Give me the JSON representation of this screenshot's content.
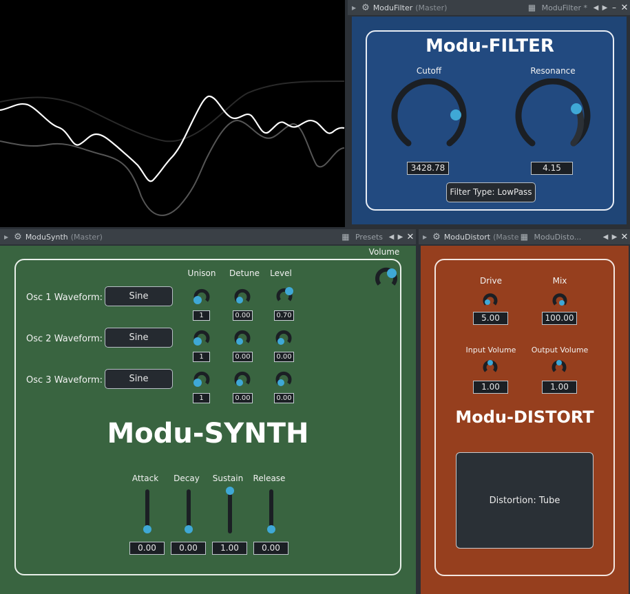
{
  "filter_window": {
    "title": "ModuFilter",
    "subtitle": "(Master)",
    "preset_label": "ModuFilter *",
    "plugin_title": "Modu-FILTER",
    "cutoff_label": "Cutoff",
    "cutoff_value": "3428.78",
    "resonance_label": "Resonance",
    "resonance_value": "4.15",
    "filter_type_button": "Filter Type: LowPass"
  },
  "synth_window": {
    "title": "ModuSynth",
    "subtitle": "(Master)",
    "preset_label": "Presets",
    "volume_label": "Volume",
    "plugin_title": "Modu-SYNTH",
    "column_labels": [
      "Unison",
      "Detune",
      "Level"
    ],
    "oscillators": [
      {
        "label": "Osc 1 Waveform:",
        "waveform": "Sine",
        "unison": "1",
        "detune": "0.00",
        "level": "0.70"
      },
      {
        "label": "Osc 2 Waveform:",
        "waveform": "Sine",
        "unison": "1",
        "detune": "0.00",
        "level": "0.00"
      },
      {
        "label": "Osc 3 Waveform:",
        "waveform": "Sine",
        "unison": "1",
        "detune": "0.00",
        "level": "0.00"
      }
    ],
    "envelope": [
      {
        "label": "Attack",
        "value": "0.00",
        "level": 0.0
      },
      {
        "label": "Decay",
        "value": "0.00",
        "level": 0.0
      },
      {
        "label": "Sustain",
        "value": "1.00",
        "level": 1.0
      },
      {
        "label": "Release",
        "value": "0.00",
        "level": 0.0
      }
    ]
  },
  "distort_window": {
    "title": "ModuDistort",
    "subtitle": "(Maste",
    "preset_label": "ModuDisto...",
    "plugin_title": "Modu-DISTORT",
    "drive_label": "Drive",
    "drive_value": "5.00",
    "mix_label": "Mix",
    "mix_value": "100.00",
    "input_volume_label": "Input Volume",
    "input_volume_value": "1.00",
    "output_volume_label": "Output Volume",
    "output_volume_value": "1.00",
    "distortion_type": "Distortion: Tube"
  },
  "colors": {
    "filter_bg": "#1f4576",
    "synth_bg": "#396440",
    "distort_bg": "#963f1e",
    "knob_accent": "#3fa8d6",
    "knob_track": "#1b1f24"
  },
  "icons": [
    "gear-icon",
    "arrow-left-icon",
    "arrow-right-icon",
    "close-icon",
    "minimize-icon",
    "grid-icon",
    "expand-triangle-icon"
  ]
}
